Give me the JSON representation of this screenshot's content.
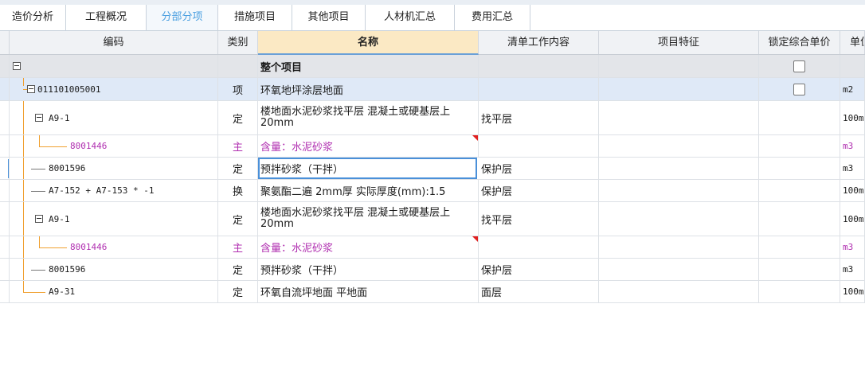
{
  "tabs": [
    "造价分析",
    "工程概况",
    "分部分项",
    "措施项目",
    "其他项目",
    "人材机汇总",
    "费用汇总"
  ],
  "active_tab": "分部分项",
  "columns": {
    "code": "编码",
    "type": "类别",
    "name": "名称",
    "work": "清单工作内容",
    "feature": "项目特征",
    "lock": "锁定综合单价",
    "unit": "单位"
  },
  "rows": [
    {
      "code": "",
      "type": "",
      "name": "整个项目",
      "work": "",
      "unit": "",
      "lock": true
    },
    {
      "code": "011101005001",
      "type": "项",
      "name": "环氧地坪涂层地面",
      "work": "",
      "unit": "m2",
      "lock": true
    },
    {
      "code": "A9-1",
      "type": "定",
      "name": "楼地面水泥砂浆找平层 混凝土或硬基层上 20mm",
      "work": "找平层",
      "unit": "100m"
    },
    {
      "code": "8001446",
      "type": "主",
      "name": "含量：水泥砂浆",
      "work": "",
      "unit": "m3"
    },
    {
      "code": "8001596",
      "type": "定",
      "name": "预拌砂浆（干拌）",
      "work": "保护层",
      "unit": "m3"
    },
    {
      "code": "A7-152 + A7-153 * -1",
      "type": "换",
      "name": "聚氨酯二遍 2mm厚  实际厚度(mm):1.5",
      "work": "保护层",
      "unit": "100m"
    },
    {
      "code": "A9-1",
      "type": "定",
      "name": "楼地面水泥砂浆找平层 混凝土或硬基层上 20mm",
      "work": "找平层",
      "unit": "100m"
    },
    {
      "code": "8001446",
      "type": "主",
      "name": "含量：水泥砂浆",
      "work": "",
      "unit": "m3"
    },
    {
      "code": "8001596",
      "type": "定",
      "name": "预拌砂浆（干拌）",
      "work": "保护层",
      "unit": "m3"
    },
    {
      "code": "A9-31",
      "type": "定",
      "name": "环氧自流坪地面 平地面",
      "work": "面层",
      "unit": "100m"
    }
  ]
}
